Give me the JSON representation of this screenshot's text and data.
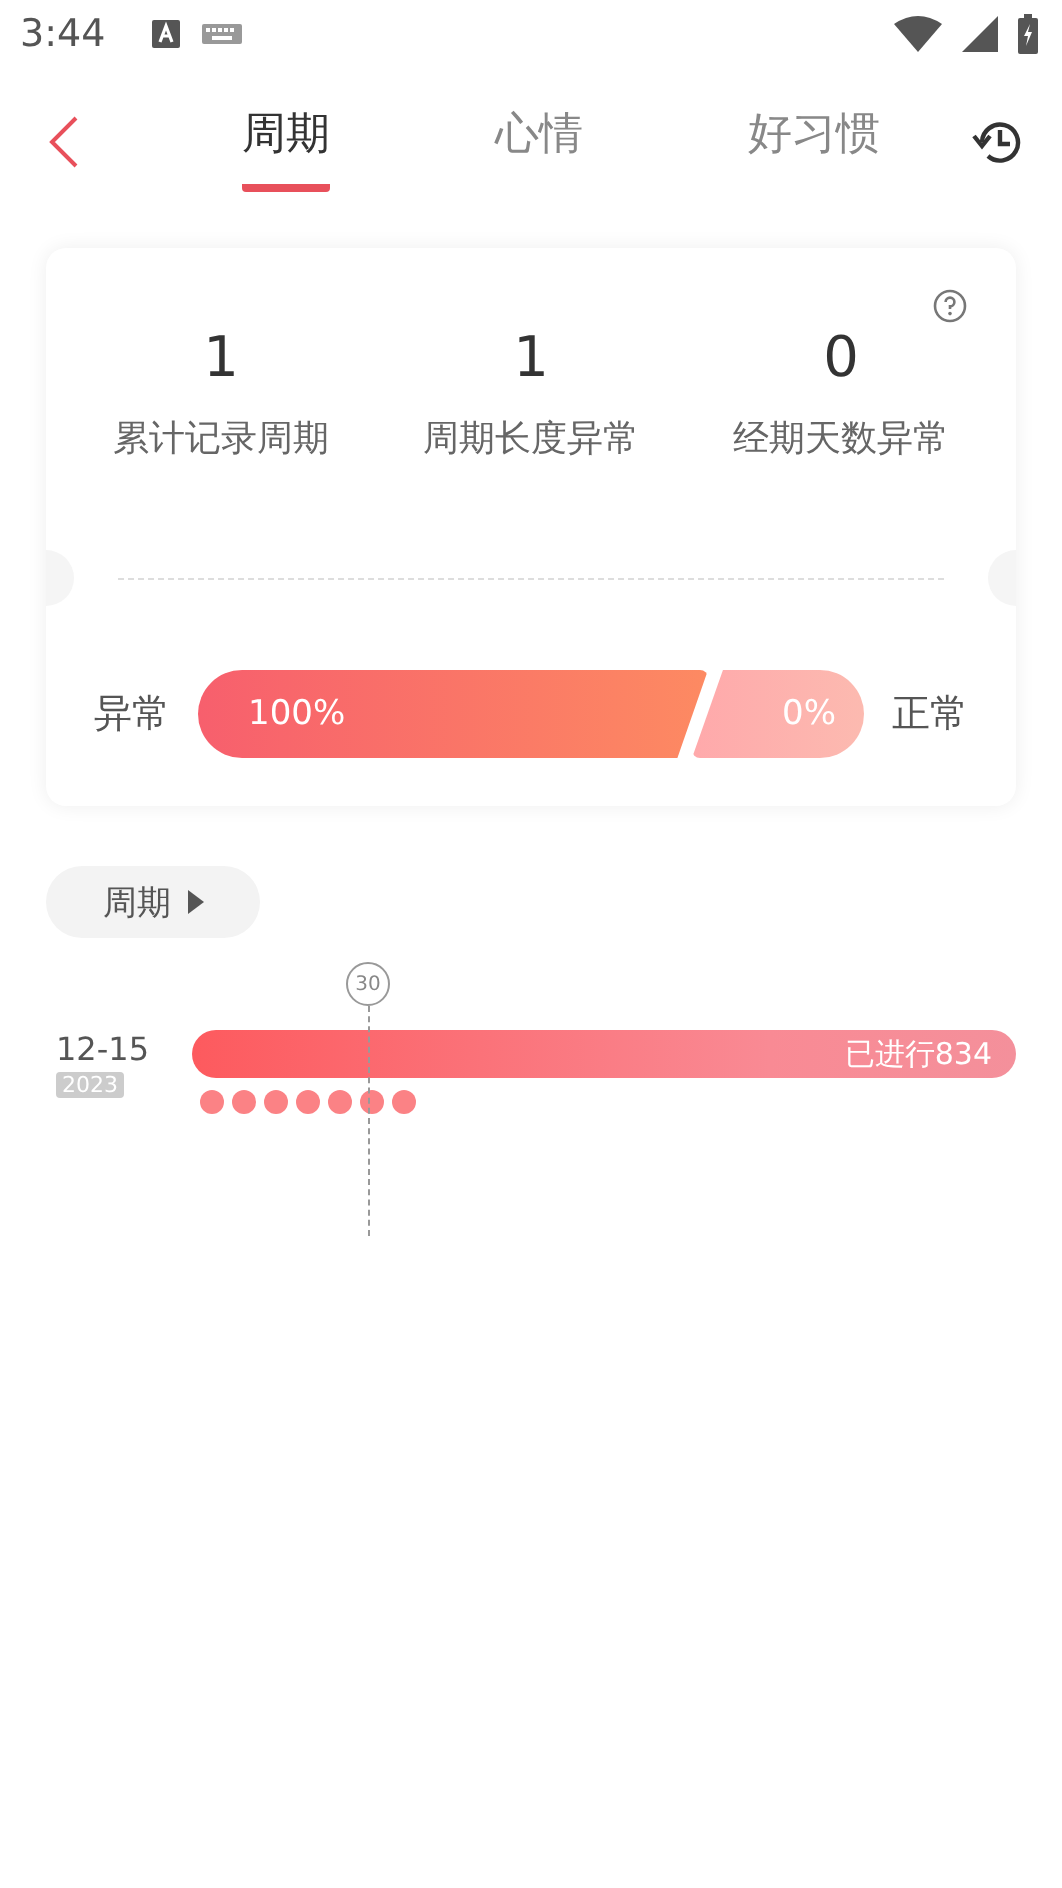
{
  "status_bar": {
    "time": "3:44"
  },
  "tabs": [
    {
      "label": "周期",
      "selected": true
    },
    {
      "label": "心情",
      "selected": false
    },
    {
      "label": "好习惯",
      "selected": false
    }
  ],
  "summary": {
    "stats": [
      {
        "value": "1",
        "label": "累计记录周期"
      },
      {
        "value": "1",
        "label": "周期长度异常"
      },
      {
        "value": "0",
        "label": "经期天数异常"
      }
    ],
    "ratio": {
      "left_label": "异常",
      "abnormal": "100%",
      "normal": "0%",
      "right_label": "正常"
    }
  },
  "filter": {
    "label": "周期"
  },
  "timeline": {
    "marker": "30",
    "rows": [
      {
        "date": "12-15",
        "year": "2023",
        "progress": "已进行834",
        "period_dots": [
          {
            "kind": "period"
          },
          {
            "kind": "period"
          },
          {
            "kind": "period"
          },
          {
            "kind": "period"
          },
          {
            "kind": "period"
          },
          {
            "kind": "period"
          },
          {
            "kind": "period"
          }
        ]
      }
    ]
  }
}
